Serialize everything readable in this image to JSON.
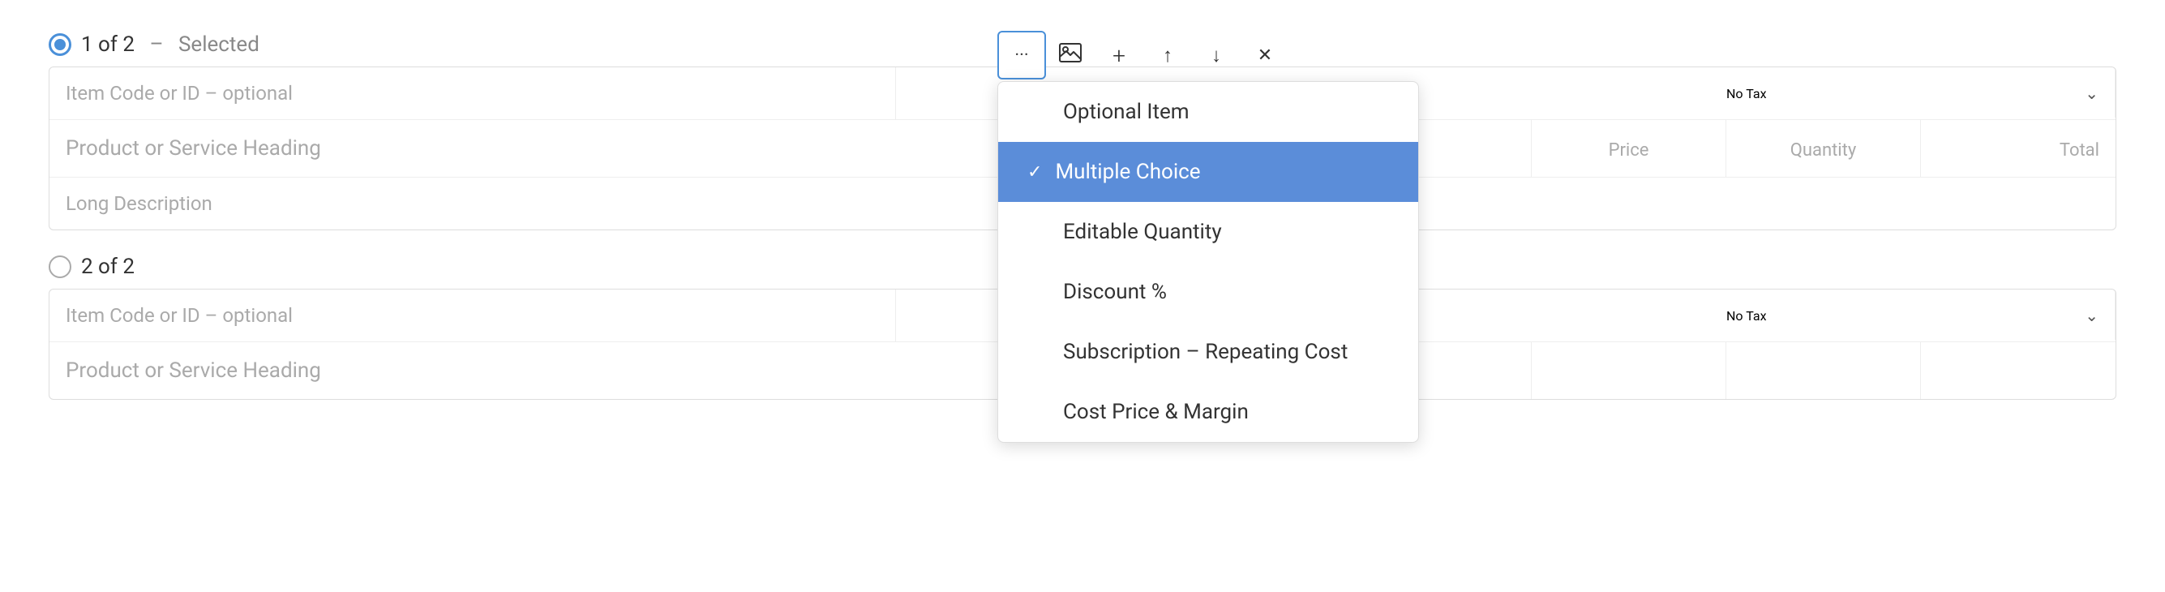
{
  "row1": {
    "selector": "1 of 2",
    "dash": "–",
    "selected_label": "Selected"
  },
  "row2": {
    "selector": "2 of 2"
  },
  "toolbar": {
    "more_icon": "···",
    "image_icon": "🖼",
    "add_icon": "+",
    "up_icon": "↑",
    "down_icon": "↓",
    "close_icon": "✕"
  },
  "form1": {
    "item_code_placeholder": "Item Code or ID – optional",
    "heading_placeholder": "Product or Service Heading",
    "description_placeholder": "Long Description",
    "tax_value": "No Tax",
    "price_label": "Price",
    "quantity_label": "Quantity",
    "total_label": "Total"
  },
  "form2": {
    "item_code_placeholder": "Item Code or ID – optional",
    "heading_placeholder": "Product or Service Heading",
    "tax_value": "No Tax"
  },
  "dropdown": {
    "items": [
      {
        "id": "optional-item",
        "label": "Optional Item",
        "checked": false
      },
      {
        "id": "multiple-choice",
        "label": "Multiple Choice",
        "checked": true
      },
      {
        "id": "editable-quantity",
        "label": "Editable Quantity",
        "checked": false
      },
      {
        "id": "discount-percent",
        "label": "Discount %",
        "checked": false
      },
      {
        "id": "subscription-repeating",
        "label": "Subscription – Repeating Cost",
        "checked": false
      },
      {
        "id": "cost-price-margin",
        "label": "Cost Price & Margin",
        "checked": false
      }
    ]
  }
}
